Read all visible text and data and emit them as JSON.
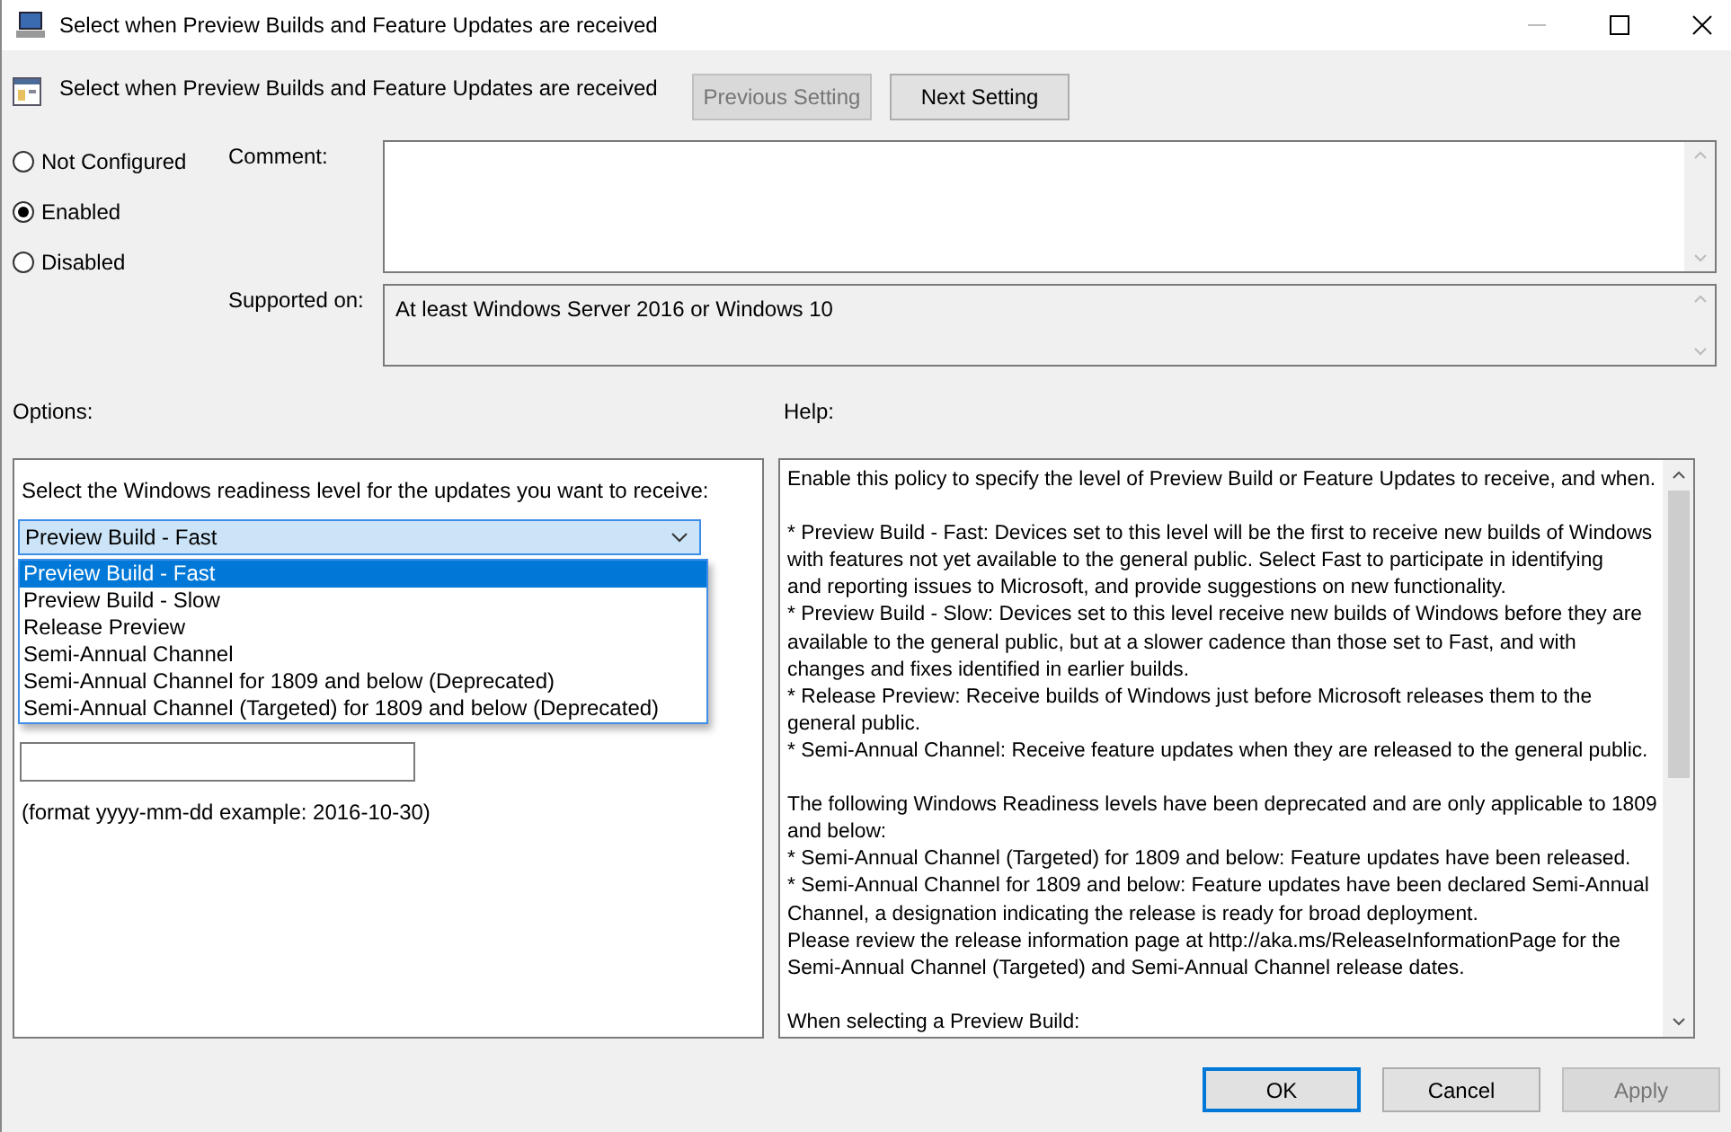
{
  "window": {
    "title": "Select when Preview Builds and Feature Updates are received"
  },
  "header": {
    "title": "Select when Preview Builds and Feature Updates are received",
    "buttons": [
      {
        "label": "Previous Setting",
        "disabled": true
      },
      {
        "label": "Next Setting",
        "disabled": false
      }
    ]
  },
  "state_options": [
    {
      "label": "Not Configured",
      "selected": false
    },
    {
      "label": "Enabled",
      "selected": true
    },
    {
      "label": "Disabled",
      "selected": false
    }
  ],
  "comment": {
    "label": "Comment:"
  },
  "supported_on": {
    "label": "Supported on:",
    "value": "At least Windows Server 2016 or Windows 10"
  },
  "options": {
    "label": "Options:",
    "prompt": "Select the Windows readiness level for the updates you want to receive:",
    "dropdown": {
      "value": "Preview Build - Fast",
      "items": [
        {
          "label": "Preview Build - Fast",
          "selected": true
        },
        {
          "label": "Preview Build - Slow",
          "selected": false
        },
        {
          "label": "Release Preview",
          "selected": false
        },
        {
          "label": "Semi-Annual Channel",
          "selected": false
        },
        {
          "label": "Semi-Annual Channel for 1809 and below (Deprecated)",
          "selected": false
        },
        {
          "label": "Semi-Annual Channel (Targeted) for 1809 and below (Deprecated)",
          "selected": false
        }
      ]
    },
    "date_hint": "(format yyyy-mm-dd example: 2016-10-30)"
  },
  "help": {
    "label": "Help:",
    "paragraphs": [
      [
        "Enable this policy to specify the level of Preview Build or Feature Updates to receive, and when."
      ],
      [
        "* Preview Build - Fast: Devices set to this level will be the first to receive new builds of Windows",
        "with features not yet available to the general public. Select Fast to participate in identifying",
        "and reporting issues to Microsoft, and provide suggestions on new functionality.",
        "* Preview Build - Slow: Devices set to this level receive new builds of Windows before they are",
        "available to the general public, but at a slower cadence than those set to Fast, and with",
        "changes and fixes identified in earlier builds.",
        "* Release Preview: Receive builds of Windows just before Microsoft releases them to the",
        "general public.",
        "* Semi-Annual Channel: Receive feature updates when they are released to the general public."
      ],
      [
        "The following Windows Readiness levels have been deprecated and are only applicable to 1809",
        "and below:",
        "* Semi-Annual Channel (Targeted) for 1809 and below: Feature updates have been released.",
        "* Semi-Annual Channel for 1809 and below: Feature updates have been declared Semi-Annual",
        "Channel, a designation indicating the release is ready for broad deployment.",
        "Please review the release information page at http://aka.ms/ReleaseInformationPage for the",
        "Semi-Annual Channel (Targeted) and Semi-Annual Channel release dates."
      ],
      [
        "When selecting a Preview Build:"
      ]
    ]
  },
  "footer_buttons": [
    {
      "label": "OK",
      "kind": "default",
      "disabled": false
    },
    {
      "label": "Cancel",
      "kind": "normal",
      "disabled": false
    },
    {
      "label": "Apply",
      "kind": "normal",
      "disabled": true
    }
  ]
}
